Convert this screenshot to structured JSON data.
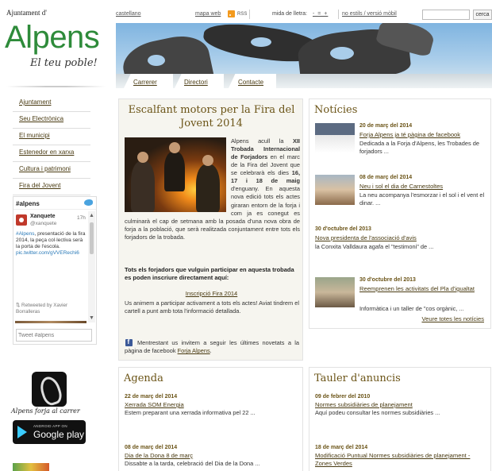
{
  "site": {
    "title": "Ajuntament d'",
    "logo": "Alpens",
    "tagline": "El teu poble!"
  },
  "topbar": {
    "lang": "castellano",
    "map": "mapa web",
    "rss": "RSS",
    "fontsize_label": "mida de lletra:",
    "fontsize_ctrls": "- = +",
    "nostyle": "no estils / versió mòbil",
    "search_value": "",
    "search_button": "cerca"
  },
  "banner": {
    "tabs": [
      "Carrerer",
      "Directori",
      "Contacte"
    ]
  },
  "leftnav": [
    "Ajuntament",
    "Seu Electrònica",
    "El municipi",
    "Estenedor en xarxa",
    "Cultura i patrimoni",
    "Fira del Jovent"
  ],
  "twitter": {
    "hashtag": "#alpens",
    "user": "Xanquete",
    "handle": "@xanquete",
    "time": "17h",
    "text_hashtag": "#Alpens",
    "text_body": ", presentació de la fira 2014, la peça col·lectiva serà la porta de l'escola.",
    "text_link": "pic.twitter.com/gVVERechi6",
    "retweet": "⇅ Retweeted by Xavier Borralleras",
    "input_placeholder": "Tweet #alpens"
  },
  "app": {
    "caption": "Alpens forja al carrer",
    "gplay_small": "ANDROID APP ON",
    "gplay_big": "Google play"
  },
  "featured": {
    "title": "Escalfant motors per la Fira del Jovent 2014",
    "p1_a": "Alpens acull la ",
    "p1_b": "XII Trobada Internacional de Forjadors",
    "p1_c": " en el marc de la Fira del Jovent que se celebrarà els dies ",
    "p1_d": "16, 17 i 18 de maig",
    "p1_e": " d'enguany. En aquesta nova edició tots els actes giraran entorn de la forja i com ja es conegut es culminarà el cap de setmana amb la posada d'una nova obra de forja a la població, que serà realitzada conjuntament entre tots els forjadors de la trobada.",
    "cta_heading": "Tots els forjadors que vulguin participar en aquesta trobada es poden inscriure directament aquí:",
    "cta_link": "Inscripció Fira 2014",
    "cta_text": "Us animem a participar activament a tots els actes! Aviat tindrem el cartell a punt amb tota l'informació detallada.",
    "fb_text_a": "Mentrestant us invitem a seguir les últimes novetats a la pàgina de facebook ",
    "fb_link": "Forja Alpens",
    "fb_text_b": "."
  },
  "news": {
    "title": "Notícies",
    "items": [
      {
        "date": "20 de març del 2014",
        "title": "Forja Alpens ja té pàgina de facebook",
        "summary": "Dedicada a la Forja d'Alpens, les Trobades de forjadors ..."
      },
      {
        "date": "08 de març del 2014",
        "title": "Neu i sol el dia de Carnestoltes",
        "summary": "La neu acompanya l'esmorzar i el sol i el vent el dinar. ..."
      },
      {
        "date": "30 d'octubre del 2013",
        "title": "Nova presidenta de l'associació d'avis",
        "summary": "la Conxita Valldaura agafa el \"testimoni\" de ..."
      },
      {
        "date": "30 d'octubre del 2013",
        "title": "Reemprenen les activitats del Pla d'igualtat",
        "summary": "Informàtica i un taller de \"cos orgànic, ..."
      }
    ],
    "more": "Veure totes les notícies"
  },
  "agenda": {
    "title": "Agenda",
    "items": [
      {
        "date": "22 de març del 2014",
        "title": "Xerrada SOM Energia",
        "summary": "Estem preparant una xerrada informativa pel 22 ..."
      },
      {
        "date": "08 de març del 2014",
        "title": "Dia de la Dona 8 de març",
        "summary": "Dissabte a la tarda, celebració del Dia de la Dona ..."
      }
    ]
  },
  "tauler": {
    "title": "Tauler d'anuncis",
    "items": [
      {
        "date": "09 de febrer del 2010",
        "title": "Normes subsidiàries de planejament",
        "summary": "Aquí podeu consultar les normes subsidiàries ..."
      },
      {
        "date": "18 de març del 2014",
        "title": "Modificació Puntual Normes subsidiàries de planejament - Zones Verdes",
        "summary": ""
      }
    ]
  },
  "colors": {
    "logo_green": "#2e8b3a",
    "heading_brown": "#6b5417",
    "link_brown": "#4a3b12"
  }
}
